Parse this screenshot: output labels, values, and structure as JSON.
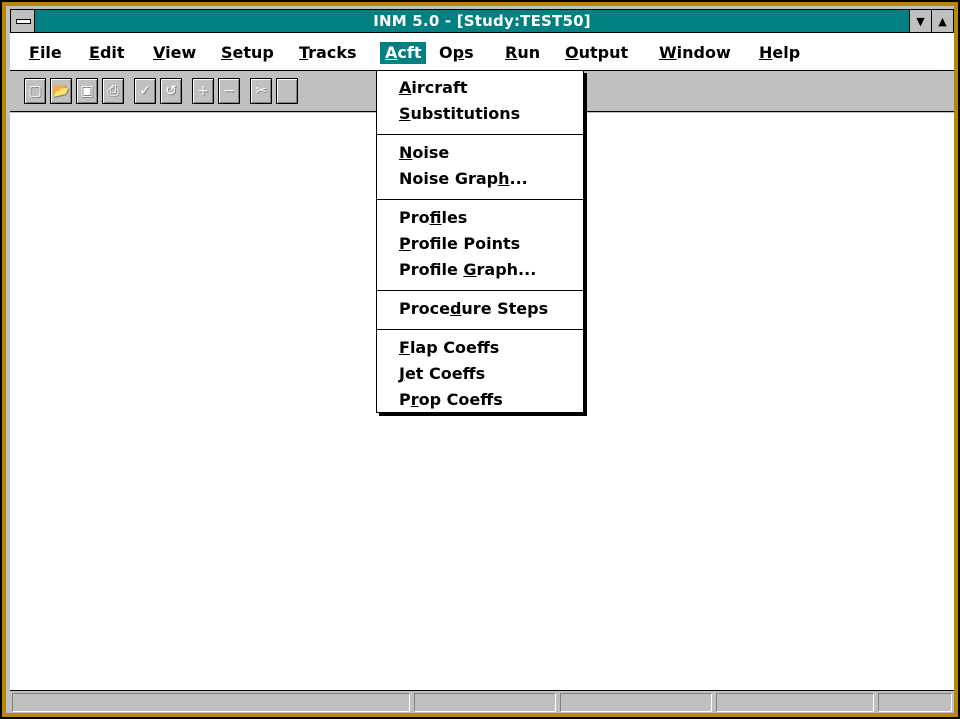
{
  "window": {
    "title": "INM 5.0 - [Study:TEST50]"
  },
  "menubar": {
    "items": [
      {
        "label": "File",
        "mnemonic": "F"
      },
      {
        "label": "Edit",
        "mnemonic": "E"
      },
      {
        "label": "View",
        "mnemonic": "V"
      },
      {
        "label": "Setup",
        "mnemonic": "S"
      },
      {
        "label": "Tracks",
        "mnemonic": "T"
      },
      {
        "label": "Acft",
        "mnemonic": "A",
        "active": true
      },
      {
        "label": "Ops",
        "mnemonic": "p"
      },
      {
        "label": "Run",
        "mnemonic": "R"
      },
      {
        "label": "Output",
        "mnemonic": "O"
      },
      {
        "label": "Window",
        "mnemonic": "W"
      },
      {
        "label": "Help",
        "mnemonic": "H"
      }
    ]
  },
  "toolbar": {
    "buttons": [
      {
        "name": "new-file-button",
        "icon": "new-file-icon",
        "glyph": "▢"
      },
      {
        "name": "open-button",
        "icon": "open-folder-icon",
        "glyph": "📂"
      },
      {
        "name": "save-button",
        "icon": "floppy-disk-icon",
        "glyph": "▣"
      },
      {
        "name": "print-button",
        "icon": "printer-icon",
        "glyph": "⎙"
      },
      {
        "name": "check-button",
        "icon": "checkmark-icon",
        "glyph": "✓"
      },
      {
        "name": "undo-button",
        "icon": "undo-icon",
        "glyph": "↺"
      },
      {
        "name": "add-button",
        "icon": "plus-icon",
        "glyph": "+"
      },
      {
        "name": "remove-button",
        "icon": "minus-icon",
        "glyph": "−"
      },
      {
        "name": "cut-button",
        "icon": "scissors-icon",
        "glyph": "✂"
      }
    ]
  },
  "acft_menu": {
    "groups": [
      [
        {
          "label": "Aircraft",
          "mnemonic": "A"
        },
        {
          "label": "Substitutions",
          "mnemonic": "S"
        }
      ],
      [
        {
          "label": "Noise",
          "mnemonic": "N"
        },
        {
          "label": "Noise Graph...",
          "mnemonic": "h"
        }
      ],
      [
        {
          "label": "Profiles",
          "mnemonic": "f"
        },
        {
          "label": "Profile Points",
          "mnemonic": "P"
        },
        {
          "label": "Profile Graph...",
          "mnemonic": "G"
        }
      ],
      [
        {
          "label": "Procedure Steps",
          "mnemonic": "d"
        }
      ],
      [
        {
          "label": "Flap Coeffs",
          "mnemonic": "F"
        },
        {
          "label": "Jet Coeffs",
          "mnemonic": "J"
        },
        {
          "label": "Prop Coeffs",
          "mnemonic": "r"
        }
      ]
    ]
  },
  "colors": {
    "titlebar": "#008080",
    "menu_highlight": "#008080",
    "frame": "#b8860b",
    "chrome": "#c0c0c0"
  }
}
